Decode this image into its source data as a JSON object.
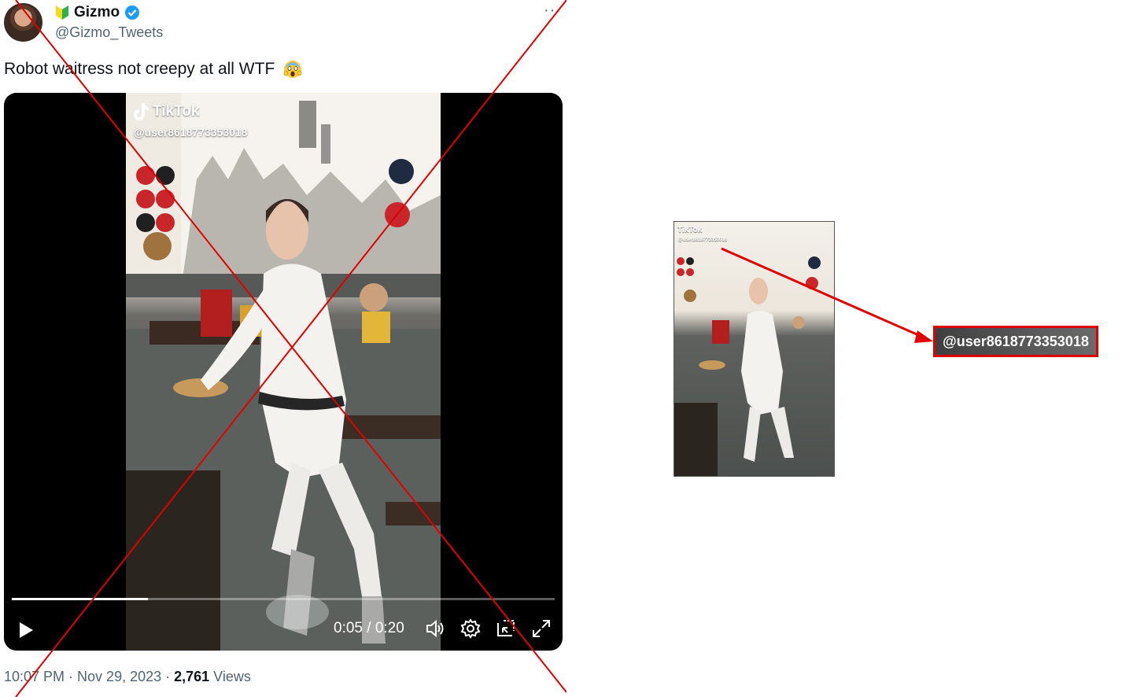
{
  "tweet": {
    "display_name": "Gizmo",
    "handle": "@Gizmo_Tweets",
    "more_label": "···",
    "text": "Robot waitress not creepy at all WTF",
    "emoji": "😱",
    "timestamp": "10:07 PM · Nov 29, 2023 · ",
    "views_count": "2,761",
    "views_label": " Views"
  },
  "video": {
    "watermark_brand": "TikTok",
    "watermark_user": "@user8618773353018",
    "current_time": "0:05",
    "separator": " / ",
    "duration": "0:20",
    "progress": 0.25
  },
  "callout": {
    "thumb_brand": "TikTok",
    "thumb_user": "@user8618773353018",
    "zoom_text": "@user8618773353018"
  },
  "colors": {
    "cross": "#e00000",
    "verified": "#1d9bf0",
    "muted_text": "#536471"
  },
  "icons": [
    "beginner-mark-icon",
    "verified-badge-icon",
    "more-icon",
    "play-icon",
    "volume-icon",
    "settings-icon",
    "pip-icon",
    "fullscreen-icon",
    "tiktok-logo-icon"
  ]
}
